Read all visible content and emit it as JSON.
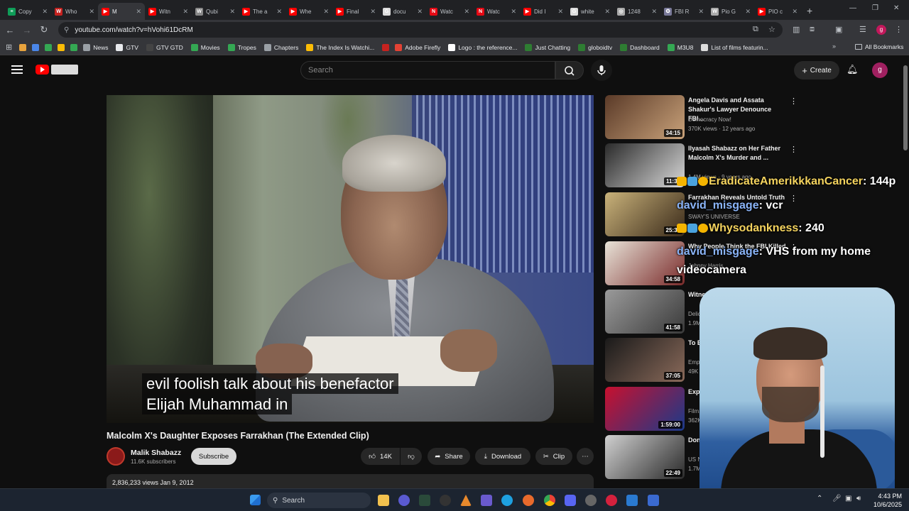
{
  "browser": {
    "tabs": [
      {
        "label": "Copy",
        "fav_color": "#0f9d58",
        "fav_glyph": "≡"
      },
      {
        "label": "Who",
        "fav_color": "#c5221f",
        "fav_glyph": "W"
      },
      {
        "label": "M",
        "fav_color": "#ff0000",
        "fav_glyph": "▶",
        "active": true
      },
      {
        "label": "Witn",
        "fav_color": "#ff0000",
        "fav_glyph": "▶"
      },
      {
        "label": "Qubi",
        "fav_color": "#888888",
        "fav_glyph": "W"
      },
      {
        "label": "The a",
        "fav_color": "#ff0000",
        "fav_glyph": "▶"
      },
      {
        "label": "Whe",
        "fav_color": "#ff0000",
        "fav_glyph": "▶"
      },
      {
        "label": "Final",
        "fav_color": "#ff0000",
        "fav_glyph": "▶"
      },
      {
        "label": "docu",
        "fav_color": "#dddddd",
        "fav_glyph": "G"
      },
      {
        "label": "Watc",
        "fav_color": "#e50914",
        "fav_glyph": "N"
      },
      {
        "label": "Watc",
        "fav_color": "#e50914",
        "fav_glyph": "N"
      },
      {
        "label": "Did I",
        "fav_color": "#ff0000",
        "fav_glyph": "▶"
      },
      {
        "label": "white",
        "fav_color": "#dddddd",
        "fav_glyph": "G"
      },
      {
        "label": "1248",
        "fav_color": "#aaaaaa",
        "fav_glyph": "◎"
      },
      {
        "label": "FBI R",
        "fav_color": "#7a7a9a",
        "fav_glyph": "✪"
      },
      {
        "label": "Pio G",
        "fav_color": "#aaaaaa",
        "fav_glyph": "W"
      },
      {
        "label": "PIO c",
        "fav_color": "#ff0000",
        "fav_glyph": "▶"
      }
    ],
    "new_tab": "+",
    "url": "youtube.com/watch?v=hVohi61DcRM",
    "bookmarks": [
      {
        "label": "",
        "color": "#e8a33d"
      },
      {
        "label": "",
        "color": "#4a86e8"
      },
      {
        "label": "",
        "color": "#34a853"
      },
      {
        "label": "",
        "color": "#fbbc05"
      },
      {
        "label": "",
        "color": "#34a853"
      },
      {
        "label": "News",
        "color": "#9aa0a6"
      },
      {
        "label": "GTV",
        "color": "#e8eaed"
      },
      {
        "label": "GTV GTD",
        "color": "#444444"
      },
      {
        "label": "Movies",
        "color": "#34a853"
      },
      {
        "label": "Tropes",
        "color": "#34a853"
      },
      {
        "label": "Chapters",
        "color": "#9aa0a6"
      },
      {
        "label": "The Index Is Watchi...",
        "color": "#fbbc05"
      },
      {
        "label": "",
        "color": "#c5221f"
      },
      {
        "label": "Adobe Firefly",
        "color": "#e34234"
      },
      {
        "label": "Logo : the reference...",
        "color": "#ffffff"
      },
      {
        "label": "Just Chatting",
        "color": "#2e7d32"
      },
      {
        "label": "globoidtv",
        "color": "#2e7d32"
      },
      {
        "label": "Dashboard",
        "color": "#2e7d32"
      },
      {
        "label": "M3U8",
        "color": "#34a853"
      },
      {
        "label": "List of films featurin...",
        "color": "#dddddd"
      }
    ],
    "all_bookmarks": "All Bookmarks"
  },
  "youtube": {
    "search_placeholder": "Search",
    "create_label": "Create",
    "avatar_letter": "g",
    "caption_lines": [
      "evil foolish talk about his benefactor",
      "Elijah Muhammad in"
    ],
    "video_title": "Malcolm X's Daughter Exposes Farrakhan (The Extended Clip)",
    "channel_name": "Malik Shabazz",
    "channel_subs": "11.6K subscribers",
    "subscribe_label": "Subscribe",
    "like_count": "14K",
    "share_label": "Share",
    "download_label": "Download",
    "clip_label": "Clip",
    "views_date": "2,836,233 views  Jan 9, 2012",
    "recommendations": [
      {
        "title": "Angela Davis and Assata Shakur's Lawyer Denounce FBI...",
        "channel": "Democracy Now!",
        "meta": "370K views · 12 years ago",
        "duration": "34:15",
        "thumb": [
          "#5a3a28",
          "#c9a27a"
        ]
      },
      {
        "title": "Ilyasah Shabazz on Her Father Malcolm X's Murder and ...",
        "channel": "",
        "meta": "1.4M views · 9 years ago",
        "duration": "11:38",
        "thumb": [
          "#2a2a2a",
          "#d9d9d9"
        ]
      },
      {
        "title": "Farrakhan Reveals Untold Truth",
        "channel": "SWAY'S UNIVERSE",
        "meta": "",
        "duration": "25:39",
        "thumb": [
          "#c9b27a",
          "#3a2a1a"
        ]
      },
      {
        "title": "Why People Think the FBI Killed",
        "channel": "Johnny Harris",
        "meta": "",
        "duration": "34:58",
        "thumb": [
          "#e8e3d8",
          "#7a2a2a"
        ]
      },
      {
        "title": "Witnessed: The A... of Malcolm...",
        "channel": "Delicatel...",
        "meta": "1.9M vi...",
        "duration": "41:58",
        "thumb": [
          "#9a9a9a",
          "#3a3a3a"
        ]
      },
      {
        "title": "To E...",
        "channel": "Emp...",
        "meta": "49K ...",
        "duration": "37:05",
        "thumb": [
          "#1a1a1a",
          "#8a6a5a"
        ]
      },
      {
        "title": "Exp... Deco...",
        "channel": "Film...",
        "meta": "362K...",
        "duration": "1:59:00",
        "thumb": [
          "#c8102e",
          "#1a3a8a"
        ]
      },
      {
        "title": "Don'...",
        "channel": "US Nat...",
        "meta": "1.7M vi...",
        "duration": "22:49",
        "thumb": [
          "#d0d0d0",
          "#2a2a2a"
        ]
      }
    ]
  },
  "stream_overlay": {
    "chat": [
      {
        "user": "EradicateAmerikkkanCancer",
        "message": "144p",
        "color": "#f4d35e",
        "badges": true
      },
      {
        "user": "david_misgage",
        "message": "vcr",
        "color": "#8ab4f8",
        "badges": false
      },
      {
        "user": "Whysodankness",
        "message": "240",
        "color": "#f4d35e",
        "badges": true
      },
      {
        "user": "david_misgage",
        "message": "VHS from my home",
        "color": "#8ab4f8",
        "badges": false
      }
    ],
    "chat_wrap": "videocamera"
  },
  "taskbar": {
    "search_label": "Search",
    "time": "4:43 PM",
    "date": "10/6/2025"
  }
}
